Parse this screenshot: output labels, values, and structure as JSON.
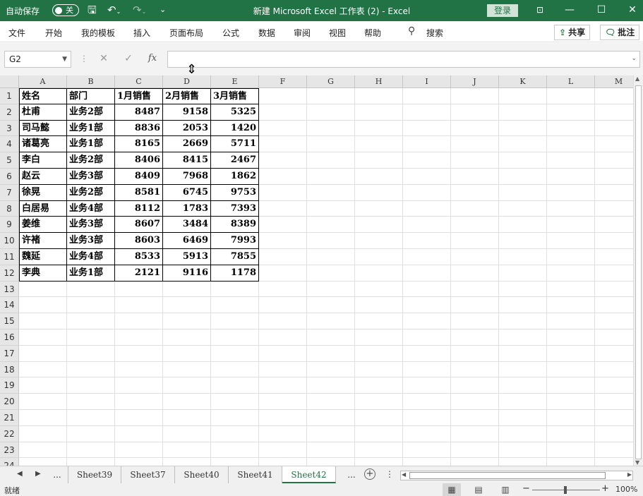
{
  "titlebar": {
    "autosave_label": "自动保存",
    "autosave_state": "关",
    "doc_title": "新建 Microsoft Excel 工作表 (2)  -  Excel",
    "login_label": "登录"
  },
  "ribbon": {
    "tabs": [
      "文件",
      "开始",
      "我的模板",
      "插入",
      "页面布局",
      "公式",
      "数据",
      "审阅",
      "视图",
      "帮助"
    ],
    "search_label": "搜索",
    "share_label": "共享",
    "comment_label": "批注"
  },
  "formula_bar": {
    "name_box": "G2",
    "fx_label": "fx",
    "formula": ""
  },
  "columns": [
    "A",
    "B",
    "C",
    "D",
    "E",
    "F",
    "G",
    "H",
    "I",
    "J",
    "K",
    "L",
    "M"
  ],
  "row_numbers": [
    "1",
    "2",
    "3",
    "4",
    "5",
    "6",
    "7",
    "8",
    "9",
    "10",
    "11",
    "12",
    "13",
    "14",
    "15",
    "16",
    "17",
    "18",
    "19",
    "20",
    "21",
    "22",
    "23",
    "24"
  ],
  "table": {
    "headers": [
      "姓名",
      "部门",
      "1月销售",
      "2月销售",
      "3月销售"
    ],
    "rows": [
      [
        "杜甫",
        "业务2部",
        "8487",
        "9158",
        "5325"
      ],
      [
        "司马懿",
        "业务1部",
        "8836",
        "2053",
        "1420"
      ],
      [
        "诸葛亮",
        "业务1部",
        "8165",
        "2669",
        "5711"
      ],
      [
        "李白",
        "业务2部",
        "8406",
        "8415",
        "2467"
      ],
      [
        "赵云",
        "业务3部",
        "8409",
        "7968",
        "1862"
      ],
      [
        "徐晃",
        "业务2部",
        "8581",
        "6745",
        "9753"
      ],
      [
        "白居易",
        "业务4部",
        "8112",
        "1783",
        "7393"
      ],
      [
        "姜维",
        "业务3部",
        "8607",
        "3484",
        "8389"
      ],
      [
        "许褚",
        "业务3部",
        "8603",
        "6469",
        "7993"
      ],
      [
        "魏延",
        "业务4部",
        "8533",
        "5913",
        "7855"
      ],
      [
        "李典",
        "业务1部",
        "2121",
        "9116",
        "1178"
      ]
    ]
  },
  "sheets": {
    "more_label": "...",
    "tabs": [
      "Sheet39",
      "Sheet37",
      "Sheet40",
      "Sheet41",
      "Sheet42"
    ],
    "active": "Sheet42"
  },
  "statusbar": {
    "ready_label": "就绪",
    "zoom_value": "100%"
  }
}
